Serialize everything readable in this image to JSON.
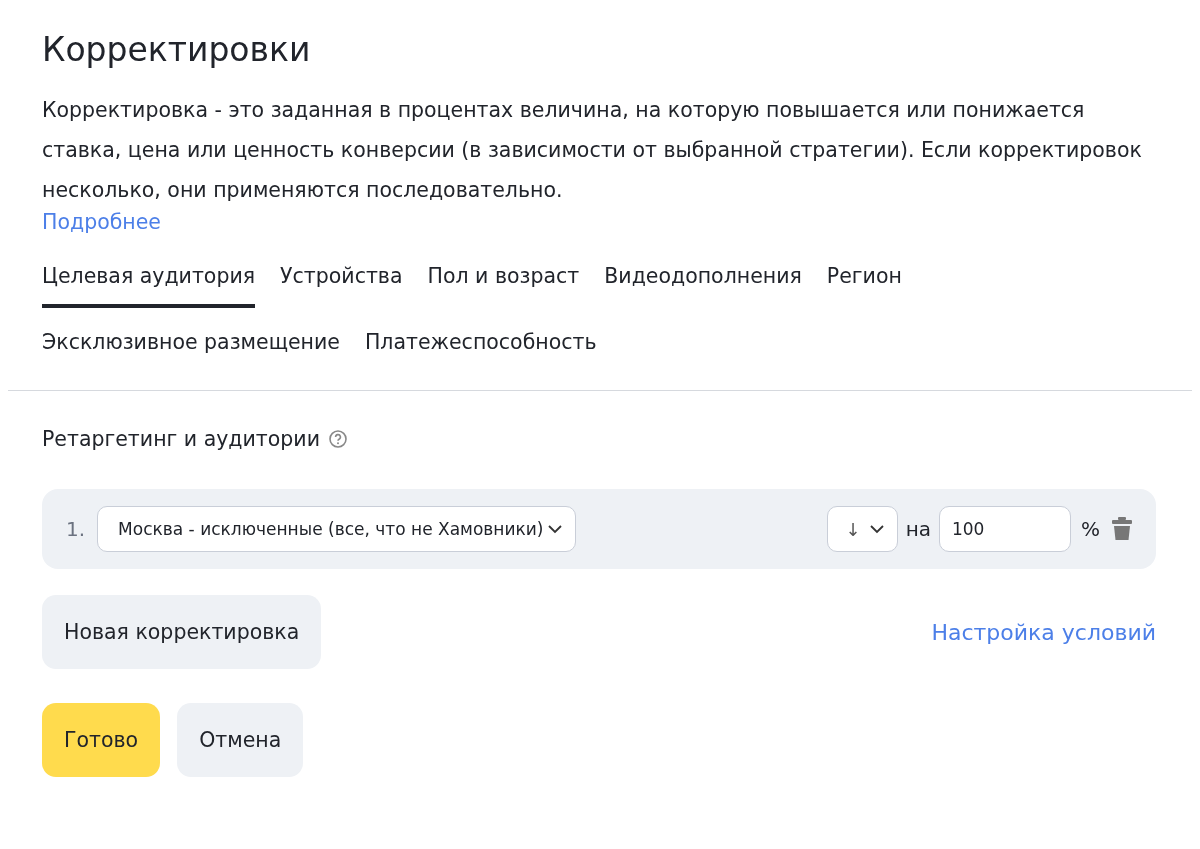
{
  "title": "Корректировки",
  "description": "Корректировка - это заданная в процентах величина, на которую повышается или понижается ставка, цена или ценность конверсии (в зависимости от выбранной стратегии). Если корректировок несколько, они применяются последовательно.",
  "more_link": "Подробнее",
  "tabs": [
    {
      "label": "Целевая аудитория",
      "selected": true
    },
    {
      "label": "Устройства",
      "selected": false
    },
    {
      "label": "Пол и возраст",
      "selected": false
    },
    {
      "label": "Видеодополнения",
      "selected": false
    },
    {
      "label": "Регион",
      "selected": false
    },
    {
      "label": "Эксклюзивное размещение",
      "selected": false
    },
    {
      "label": "Платежеспособность",
      "selected": false
    }
  ],
  "section_title": "Ретаргетинг и аудитории",
  "adjustments": [
    {
      "number": "1.",
      "audience": "Москва - исключенные (все, что не Хамовники)",
      "direction": "↓",
      "preposition": "на",
      "value": "100",
      "unit": "%"
    }
  ],
  "new_adjustment_button": "Новая корректировка",
  "conditions_link": "Настройка условий",
  "buttons": [
    {
      "label": "Готово",
      "kind": "primary"
    },
    {
      "label": "Отмена",
      "kind": "secondary"
    }
  ]
}
